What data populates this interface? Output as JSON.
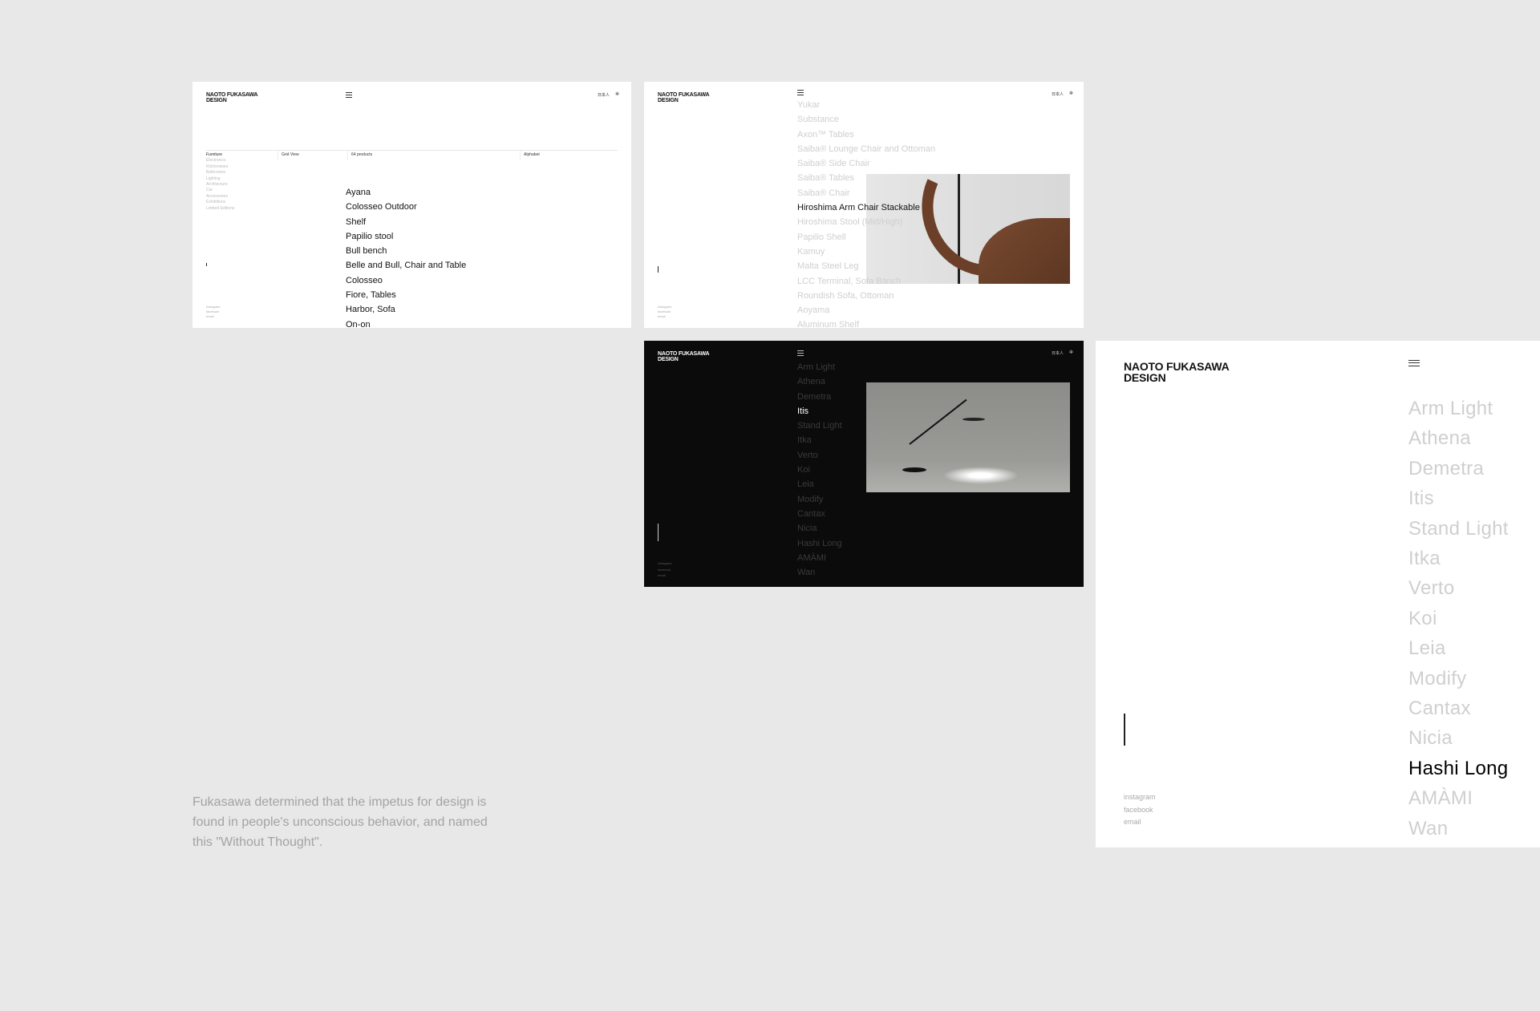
{
  "brand": {
    "line1": "NAOTO FUKASAWA",
    "line2": "DESIGN"
  },
  "header": {
    "language": "日本人",
    "settings_icon": "gear-icon",
    "menu_icon": "hamburger-icon"
  },
  "footer_links": [
    "instagram",
    "facebook",
    "email"
  ],
  "panel_furniture": {
    "categories": [
      "Furniture",
      "Electronics",
      "Kitchenware",
      "Bathrooms",
      "Lighting",
      "Architecture",
      "Car",
      "Accessories",
      "Exhibitions",
      "Limited Editions"
    ],
    "active_category": "Furniture",
    "view_toggle": "Grid View",
    "product_count": "64 products",
    "sort": "Alphabet",
    "products": [
      "Ayana",
      "Colosseo Outdoor",
      "Shelf",
      "Papilio stool",
      "Bull bench",
      "Belle and Bull, Chair and Table",
      "Colosseo",
      "Fiore, Tables",
      "Harbor, Sofa",
      "On-on"
    ]
  },
  "panel_chairs": {
    "products": [
      "Yukar",
      "Substance",
      "Axon™ Tables",
      "Saiba® Lounge Chair and Ottoman",
      "Saiba® Side Chair",
      "Saiba® Tables",
      "Saiba® Chair",
      "Hiroshima Arm Chair Stackable",
      "Hiroshima Stool (Mid/High)",
      "Papilio Shell",
      "Kamuy",
      "Malta Steel Leg",
      "LCC Terminal, Sofa Banch",
      "Roundish Sofa, Ottoman",
      "Aoyama",
      "Aluminum Shelf"
    ],
    "highlighted": "Hiroshima Arm Chair Stackable"
  },
  "panel_lights_dark": {
    "products": [
      "Arm Light",
      "Athena",
      "Demetra",
      "Itis",
      "Stand Light",
      "Itka",
      "Verto",
      "Koi",
      "Leia",
      "Modify",
      "Cantax",
      "Nicia",
      "Hashi Long",
      "AMÀMI",
      "Wan"
    ],
    "highlighted": "Itis"
  },
  "panel_lights_light": {
    "products": [
      "Arm Light",
      "Athena",
      "Demetra",
      "Itis",
      "Stand Light",
      "Itka",
      "Verto",
      "Koi",
      "Leia",
      "Modify",
      "Cantax",
      "Nicia",
      "Hashi Long",
      "AMÀMI",
      "Wan"
    ],
    "highlighted": "Hashi Long"
  },
  "caption": "Fukasawa determined that the impetus for design is found in people's unconscious behavior, and named this \"Without Thought\".",
  "colors": {
    "background": "#e8e8e8",
    "muted_text": "#cccccc",
    "active_text": "#000000",
    "dark_panel": "#0b0b0b",
    "dark_muted_text": "#3a3a3a"
  }
}
